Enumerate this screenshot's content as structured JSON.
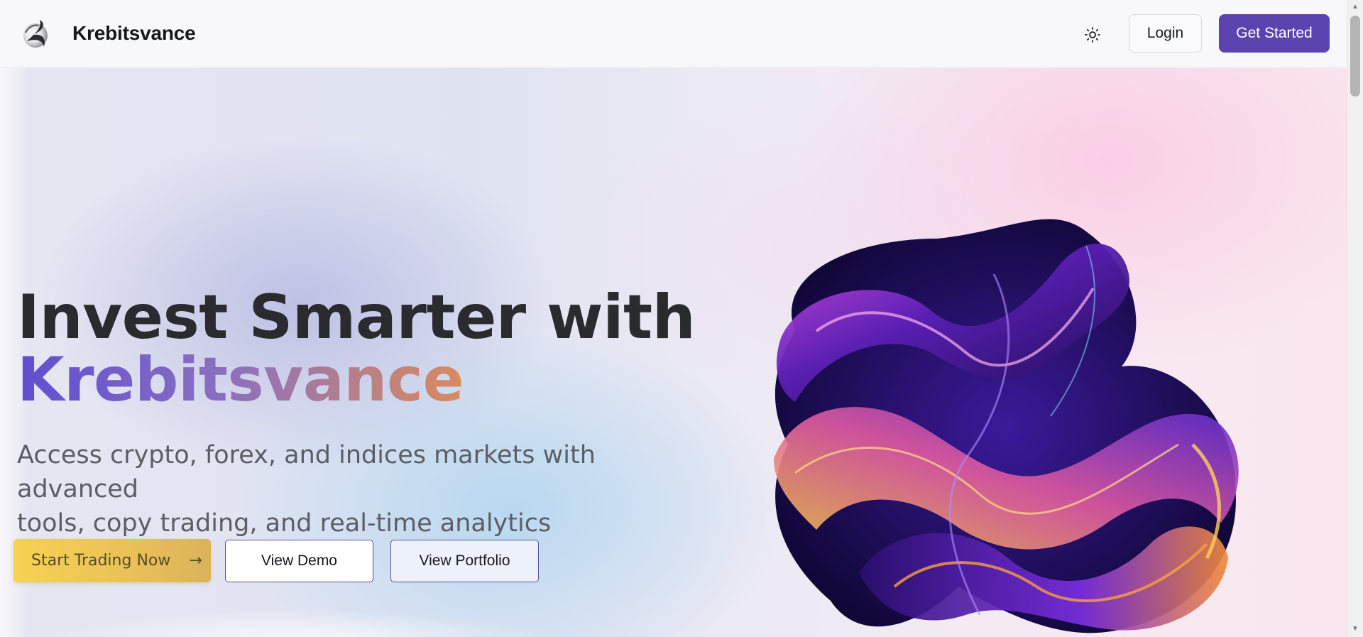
{
  "header": {
    "brand_name": "Krebitsvance",
    "theme_toggle_icon": "sun-icon",
    "login_label": "Login",
    "get_started_label": "Get Started",
    "accent_color": "#5b44b0"
  },
  "hero": {
    "title_line1": "Invest Smarter with",
    "title_line2": "Krebitsvance",
    "subtitle_line1": "Access crypto, forex, and indices markets with advanced",
    "subtitle_line2": "tools, copy trading, and real-time analytics",
    "cta_primary_label": "Start Trading Now",
    "cta_primary_icon": "arrow-right-icon",
    "cta_demo_label": "View Demo",
    "cta_portfolio_label": "View Portfolio",
    "cta_primary_color": "#f5d252",
    "art_description_icon": "abstract-glass-ribbon"
  },
  "scrollbar": {
    "up_icon": "scroll-up-arrow-icon",
    "down_icon": "scroll-down-arrow-icon"
  }
}
